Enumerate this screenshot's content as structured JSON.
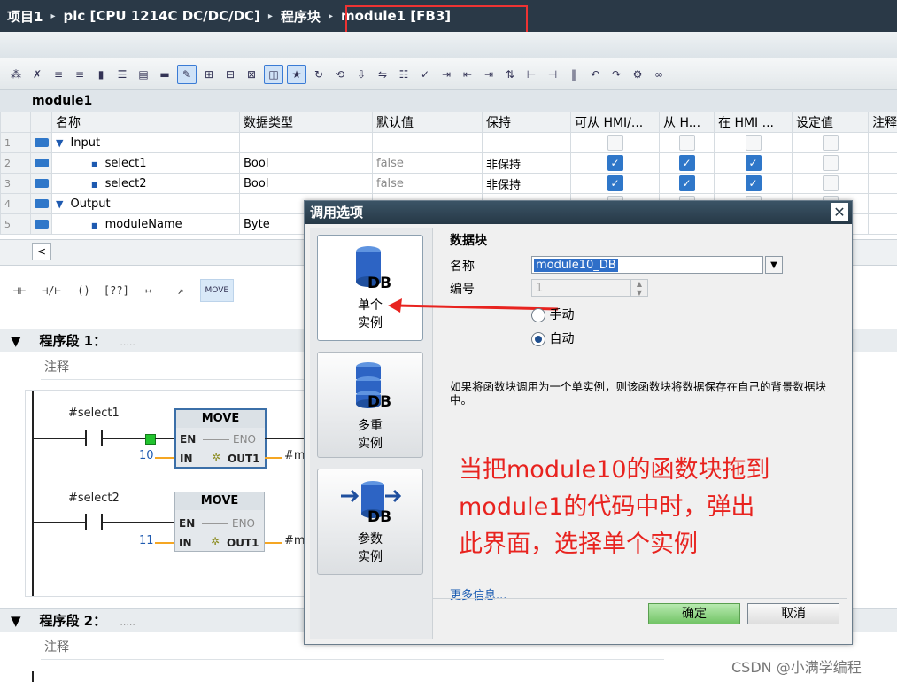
{
  "breadcrumb": {
    "items": [
      "项目1",
      "plc [CPU 1214C DC/DC/DC]",
      "程序块",
      "module1 [FB3]"
    ],
    "separator": "▸"
  },
  "block": {
    "title": "module1"
  },
  "interface": {
    "columns": [
      "名称",
      "数据类型",
      "默认值",
      "保持",
      "可从 HMI/...",
      "从 H...",
      "在 HMI ...",
      "设定值",
      "注释"
    ],
    "rows": [
      {
        "num": "1",
        "name": "Input",
        "expander": "▼",
        "type": "",
        "default": "",
        "retain": "",
        "hmi1": false,
        "hmi2": false,
        "hmi3": false,
        "setpoint": false
      },
      {
        "num": "2",
        "name": "select1",
        "expander": "■",
        "type": "Bool",
        "default": "false",
        "retain": "非保持",
        "hmi1": true,
        "hmi2": true,
        "hmi3": true,
        "setpoint": false
      },
      {
        "num": "3",
        "name": "select2",
        "expander": "■",
        "type": "Bool",
        "default": "false",
        "retain": "非保持",
        "hmi1": true,
        "hmi2": true,
        "hmi3": true,
        "setpoint": false
      },
      {
        "num": "4",
        "name": "Output",
        "expander": "▼",
        "type": "",
        "default": "",
        "retain": "",
        "hmi1": false,
        "hmi2": false,
        "hmi3": false,
        "setpoint": false
      },
      {
        "num": "5",
        "name": "moduleName",
        "expander": "■",
        "type": "Byte",
        "default": "",
        "retain": "",
        "hmi1": false,
        "hmi2": false,
        "hmi3": false,
        "setpoint": false
      }
    ],
    "scroll_left": "<"
  },
  "palette": {
    "items": [
      "⊣⊢",
      "⊣/⊢",
      "–()–",
      "[??]",
      "↦",
      "↗"
    ],
    "move_label": "MOVE"
  },
  "networks": [
    {
      "title": "程序段 1：",
      "dots": ".....",
      "comment": "注释"
    },
    {
      "title": "程序段 2：",
      "dots": ".....",
      "comment": "注释"
    }
  ],
  "ladder": {
    "rung1": {
      "contact": "#select1",
      "box": "MOVE",
      "en": "EN",
      "eno": "ENO",
      "in": "IN",
      "out": "OUT1",
      "in_value": "10",
      "out_operand": "#m"
    },
    "rung2": {
      "contact": "#select2",
      "box": "MOVE",
      "en": "EN",
      "eno": "ENO",
      "in": "IN",
      "out": "OUT1",
      "in_value": "11",
      "out_operand": "#m"
    },
    "star": "✲"
  },
  "dialog": {
    "title": "调用选项",
    "close": "✕",
    "options": [
      {
        "line1": "单个",
        "line2": "实例",
        "db": "DB"
      },
      {
        "line1": "多重",
        "line2": "实例",
        "db": "DB"
      },
      {
        "line1": "参数",
        "line2": "实例",
        "db": "DB"
      }
    ],
    "section_title": "数据块",
    "name_label": "名称",
    "name_value": "module10_DB",
    "number_label": "编号",
    "number_value": "1",
    "radio_manual": "手动",
    "radio_auto": "自动",
    "selected_radio": "auto",
    "description": "如果将函数块调用为一个单实例，则该函数块将数据保存在自己的背景数据块中。",
    "annotation": [
      "当把module10的函数块拖到",
      "module1的代码中时，弹出",
      "此界面，选择单个实例"
    ],
    "more_info": "更多信息...",
    "ok": "确定",
    "cancel": "取消"
  },
  "watermark": "CSDN @小满学编程",
  "colors": {
    "annotation": "#e8231f",
    "ok_button": "#72c466",
    "title_bar": "#263846",
    "accent": "#2f77c9"
  }
}
